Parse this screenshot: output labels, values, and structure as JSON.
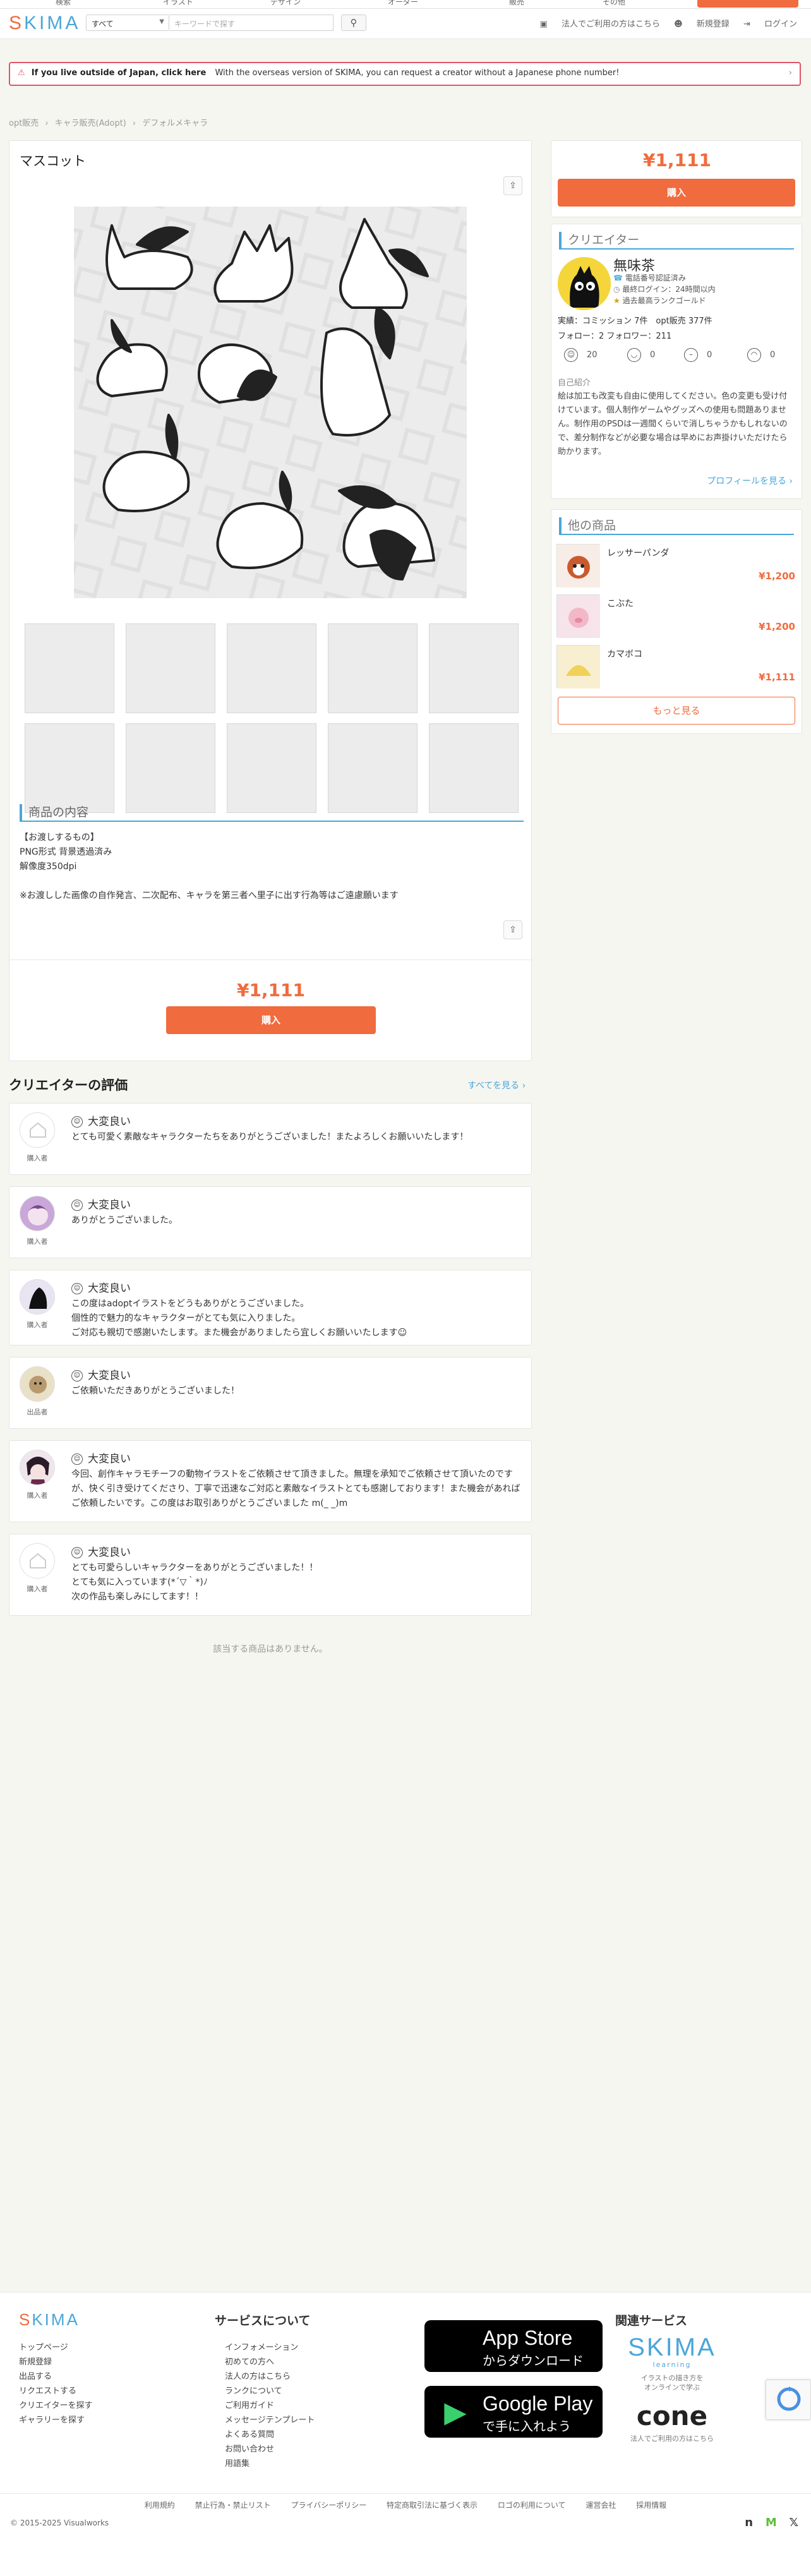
{
  "header": {
    "logo": "SKIMA",
    "top_tabs": [
      "検索",
      "イラスト",
      "デザイン",
      "オーダー",
      "販売",
      "その他"
    ],
    "category": "すべて",
    "search_placeholder": "キーワードで探す",
    "links": [
      "法人でご利用の方はこちら",
      "新規登録",
      "ログイン"
    ]
  },
  "banner": {
    "bold": "If you live outside of Japan, click here",
    "text": "With the overseas version of SKIMA, you can request a creator without a Japanese phone number!"
  },
  "breadcrumb": [
    "opt販売",
    "キャラ販売(Adopt)",
    "デフォルメキャラ"
  ],
  "product": {
    "title": "マスコット",
    "section_title": "商品の内容",
    "description": [
      "【お渡しするもの】",
      "PNG形式 背景透過済み",
      "解像度350dpi",
      "",
      "※お渡しした画像の自作発言、二次配布、キャラを第三者へ里子に出す行為等はご遠慮願います"
    ],
    "price": "¥1,111",
    "buy_label": "購入"
  },
  "creator": {
    "section_title": "クリエイター",
    "name": "無味茶",
    "badges": [
      "電話番号認証済み",
      "最終ログイン：24時間以内",
      "過去最高ランクゴールド"
    ],
    "stats_line1": "実績：コミッション 7件　opt販売 377件",
    "stats_line2": "フォロー：2 フォロワー：211",
    "ratings": [
      "20",
      "0",
      "0",
      "0"
    ],
    "intro_label": "自己紹介",
    "intro": "絵は加工も改変も自由に使用してください。色の変更も受け付けています。個人制作ゲームやグッズへの使用も問題ありません。制作用のPSDは一週間くらいで消しちゃうかもしれないので、差分制作などが必要な場合は早めにお声掛けいただけたら助かります。",
    "profile_link": "プロフィールを見る ›"
  },
  "other_products": {
    "section_title": "他の商品",
    "items": [
      {
        "name": "レッサーパンダ",
        "price": "¥1,200"
      },
      {
        "name": "こぶた",
        "price": "¥1,200"
      },
      {
        "name": "カマボコ",
        "price": "¥1,111"
      }
    ],
    "more_label": "もっと見る"
  },
  "reviews": {
    "title": "クリエイターの評価",
    "see_all": "すべてを見る ›",
    "items": [
      {
        "rating": "大変良い",
        "role": "購入者",
        "text": [
          "とても可愛く素敵なキャラクターたちをありがとうございました！またよろしくお願いいたします！"
        ]
      },
      {
        "rating": "大変良い",
        "role": "購入者",
        "text": [
          "ありがとうございました。"
        ]
      },
      {
        "rating": "大変良い",
        "role": "購入者",
        "text": [
          "この度はadoptイラストをどうもありがとうございました。",
          "個性的で魅力的なキャラクターがとても気に入りました。",
          "ご対応も親切で感謝いたします。また機会がありましたら宜しくお願いいたします☺"
        ]
      },
      {
        "rating": "大変良い",
        "role": "出品者",
        "text": [
          "ご依頼いただきありがとうございました！"
        ]
      },
      {
        "rating": "大変良い",
        "role": "購入者",
        "text": [
          "今回、創作キャラモチーフの動物イラストをご依頼させて頂きました。無理を承知でご依頼させて頂いたのですが、快く引き受けてくださり、丁寧で迅速なご対応と素敵なイラストとても感謝しております！また機会があればご依頼したいです。この度はお取引ありがとうございました m(_ _)m"
        ]
      },
      {
        "rating": "大変良い",
        "role": "購入者",
        "text": [
          "とても可愛らしいキャラクターをありがとうございました！！",
          "とても気に入っています(*´▽｀*)ﾉ",
          "次の作品も楽しみにしてます！！"
        ]
      }
    ]
  },
  "no_items": "該当する商品はありません。",
  "footer": {
    "logo": "SKIMA",
    "col1": [
      "トップページ",
      "新規登録",
      "出品する",
      "リクエストする",
      "クリエイターを探す",
      "ギャラリーを探す"
    ],
    "about_title": "サービスについて",
    "col2": [
      "インフォメーション",
      "初めての方へ",
      "法人の方はこちら",
      "ランクについて",
      "ご利用ガイド",
      "メッセージテンプレート",
      "よくある質問",
      "お問い合わせ",
      "用語集"
    ],
    "appstore_big": "App Store",
    "appstore_small": "からダウンロード",
    "googleplay_big": "Google Play",
    "googleplay_small": "で手に入れよう",
    "related_title": "関連サービス",
    "learning_logo": "SKIMA",
    "learning_sub": "learning",
    "learning_cap": "イラストの描き方を\nオンラインで学ぶ",
    "cone_logo": "cone",
    "cone_cap": "法人でご利用の方はこちら",
    "links": [
      "利用規約",
      "禁止行為・禁止リスト",
      "プライバシーポリシー",
      "特定商取引法に基づく表示",
      "ロゴの利用について",
      "運営会社",
      "採用情報"
    ],
    "copyright": "© 2015-2025 Visualworks"
  },
  "colors": {
    "accent": "#f06b3d",
    "brand_blue": "#4aa6d9",
    "banner_red": "#e0546a"
  }
}
